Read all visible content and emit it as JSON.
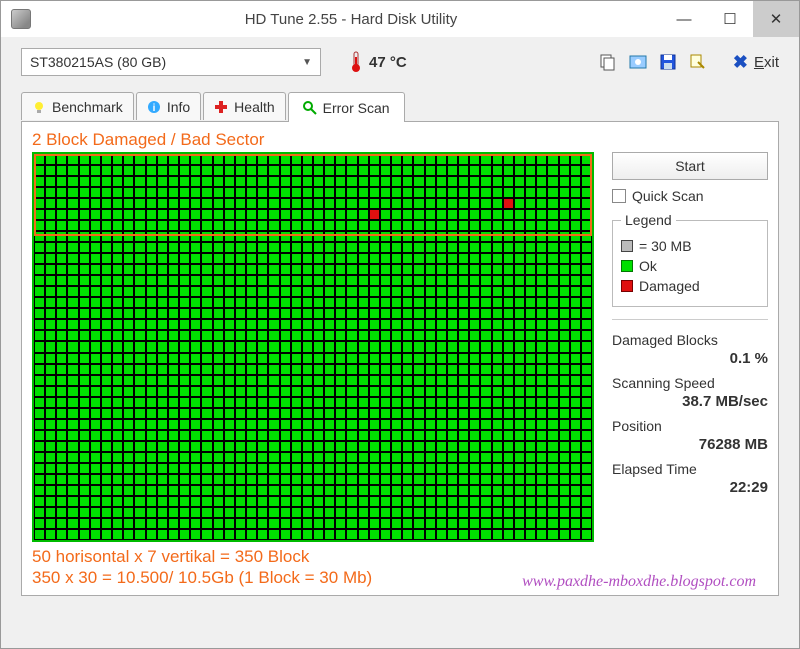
{
  "window": {
    "title": "HD Tune 2.55 - Hard Disk Utility"
  },
  "toolbar": {
    "drive": "ST380215AS (80 GB)",
    "temperature": "47 °C",
    "exit_label": "Exit"
  },
  "tabs": {
    "benchmark": "Benchmark",
    "info": "Info",
    "health": "Health",
    "error_scan": "Error Scan"
  },
  "annotations": {
    "top": "2 Block Damaged / Bad Sector",
    "bottom1": "50 horisontal x 7 vertikal = 350 Block",
    "bottom2": "350 x 30 = 10.500/ 10.5Gb (1 Block = 30 Mb)"
  },
  "side": {
    "start": "Start",
    "quick_scan": "Quick Scan",
    "legend_title": "Legend",
    "legend_size": "= 30 MB",
    "legend_ok": "Ok",
    "legend_damaged": "Damaged",
    "damaged_blocks_label": "Damaged Blocks",
    "damaged_blocks_value": "0.1 %",
    "speed_label": "Scanning Speed",
    "speed_value": "38.7 MB/sec",
    "position_label": "Position",
    "position_value": "76288 MB",
    "elapsed_label": "Elapsed Time",
    "elapsed_value": "22:29"
  },
  "scan": {
    "cols": 50,
    "rows": 35,
    "damaged_cells": [
      {
        "row": 4,
        "col": 42
      },
      {
        "row": 5,
        "col": 30
      }
    ]
  },
  "watermark": "www.paxdhe-mboxdhe.blogspot.com",
  "chart_data": {
    "type": "heatmap",
    "title": "Error Scan block map",
    "cols": 50,
    "rows": 35,
    "block_size_mb": 30,
    "legend": {
      "ok": "green",
      "damaged": "red",
      "unscanned": "gray"
    },
    "damaged": [
      [
        4,
        42
      ],
      [
        5,
        30
      ]
    ],
    "annotated_region": {
      "rows": "0-6",
      "cols": "0-49",
      "note": "350 blocks ≈ 10.5 GB"
    },
    "stats": {
      "damaged_pct": 0.1,
      "speed_mb_s": 38.7,
      "position_mb": 76288,
      "elapsed": "22:29"
    }
  }
}
